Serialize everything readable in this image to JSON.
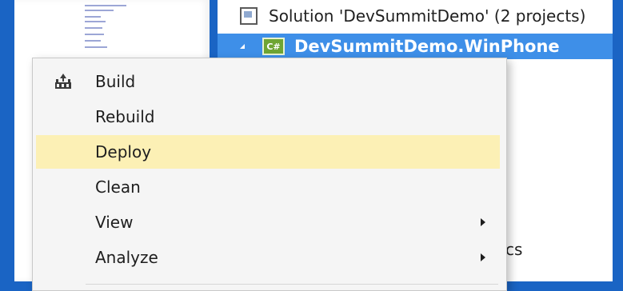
{
  "solution_explorer": {
    "solution_label": "Solution 'DevSummitDemo' (2 projects)",
    "project_label": "DevSummitDemo.WinPhone",
    "project_icon_text": "C#",
    "partial_text": "cs"
  },
  "context_menu": {
    "items": [
      {
        "label": "Build",
        "icon": "build-icon",
        "submenu": false,
        "highlighted": false
      },
      {
        "label": "Rebuild",
        "submenu": false,
        "highlighted": false
      },
      {
        "label": "Deploy",
        "submenu": false,
        "highlighted": true
      },
      {
        "label": "Clean",
        "submenu": false,
        "highlighted": false
      },
      {
        "label": "View",
        "submenu": true,
        "highlighted": false
      },
      {
        "label": "Analyze",
        "submenu": true,
        "highlighted": false
      }
    ]
  },
  "colors": {
    "background": "#1a64c4",
    "selection": "#3e8fe8",
    "highlight": "#fcf0b5",
    "menu_bg": "#f5f5f5"
  }
}
